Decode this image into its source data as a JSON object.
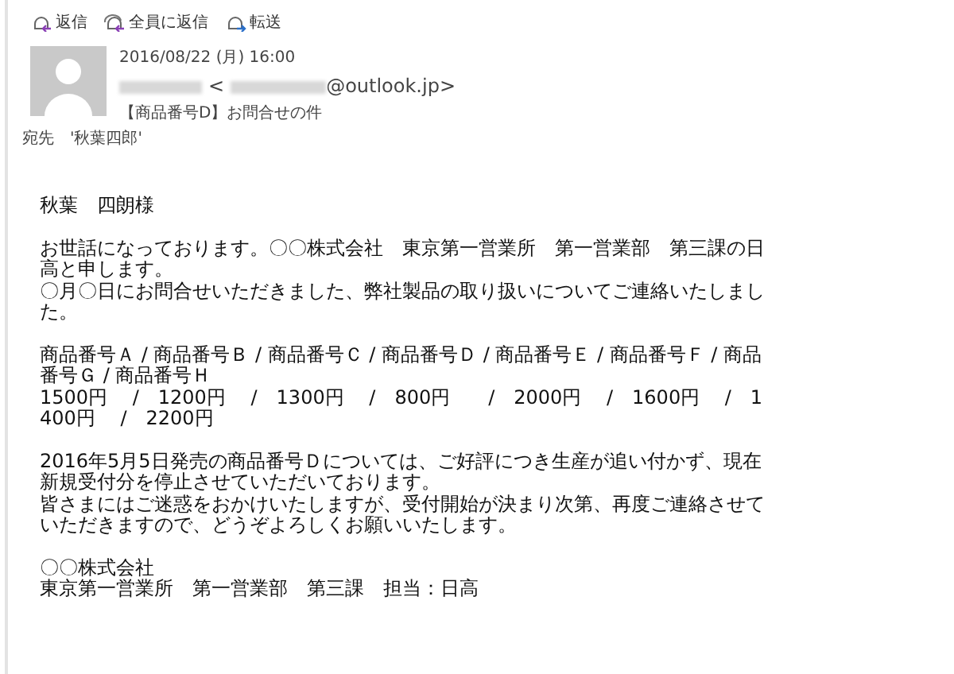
{
  "toolbar": [
    {
      "label": "返信",
      "kind": "reply"
    },
    {
      "label": "全員に返信",
      "kind": "reply-all"
    },
    {
      "label": "転送",
      "kind": "forward"
    }
  ],
  "header": {
    "date": "2016/08/22 (月) 16:00",
    "sender_open": "<",
    "sender_domain": "@outlook.jp>",
    "subject": "【商品番号D】お問合せの件",
    "to_label": "宛先",
    "to": "'秋葉四郎'"
  },
  "body": [
    [
      "秋葉　四朗様"
    ],
    [
      "お世話になっております。〇〇株式会社　東京第一営業所　第一営業部　第三課の日高と申します。",
      "〇月〇日にお問合せいただきました、弊社製品の取り扱いについてご連絡いたしました。"
    ],
    [
      "商品番号Ａ / 商品番号Ｂ / 商品番号Ｃ / 商品番号Ｄ / 商品番号Ｅ / 商品番号Ｆ / 商品番号Ｇ / 商品番号Ｈ",
      "1500円　 /　1200円　 /　1300円　 /　800円　　/　2000円　 /　1600円　 /　1400円　 /　2200円"
    ],
    [
      "2016年5月5日発売の商品番号Ｄについては、ご好評につき生産が追い付かず、現在新規受付分を停止させていただいております。",
      "皆さまにはご迷惑をおかけいたしますが、受付開始が決まり次第、再度ご連絡させていただきますので、どうぞよろしくお願いいたします。"
    ],
    [
      "〇〇株式会社",
      "東京第一営業所　第一営業部　第三課　担当：日高"
    ]
  ]
}
